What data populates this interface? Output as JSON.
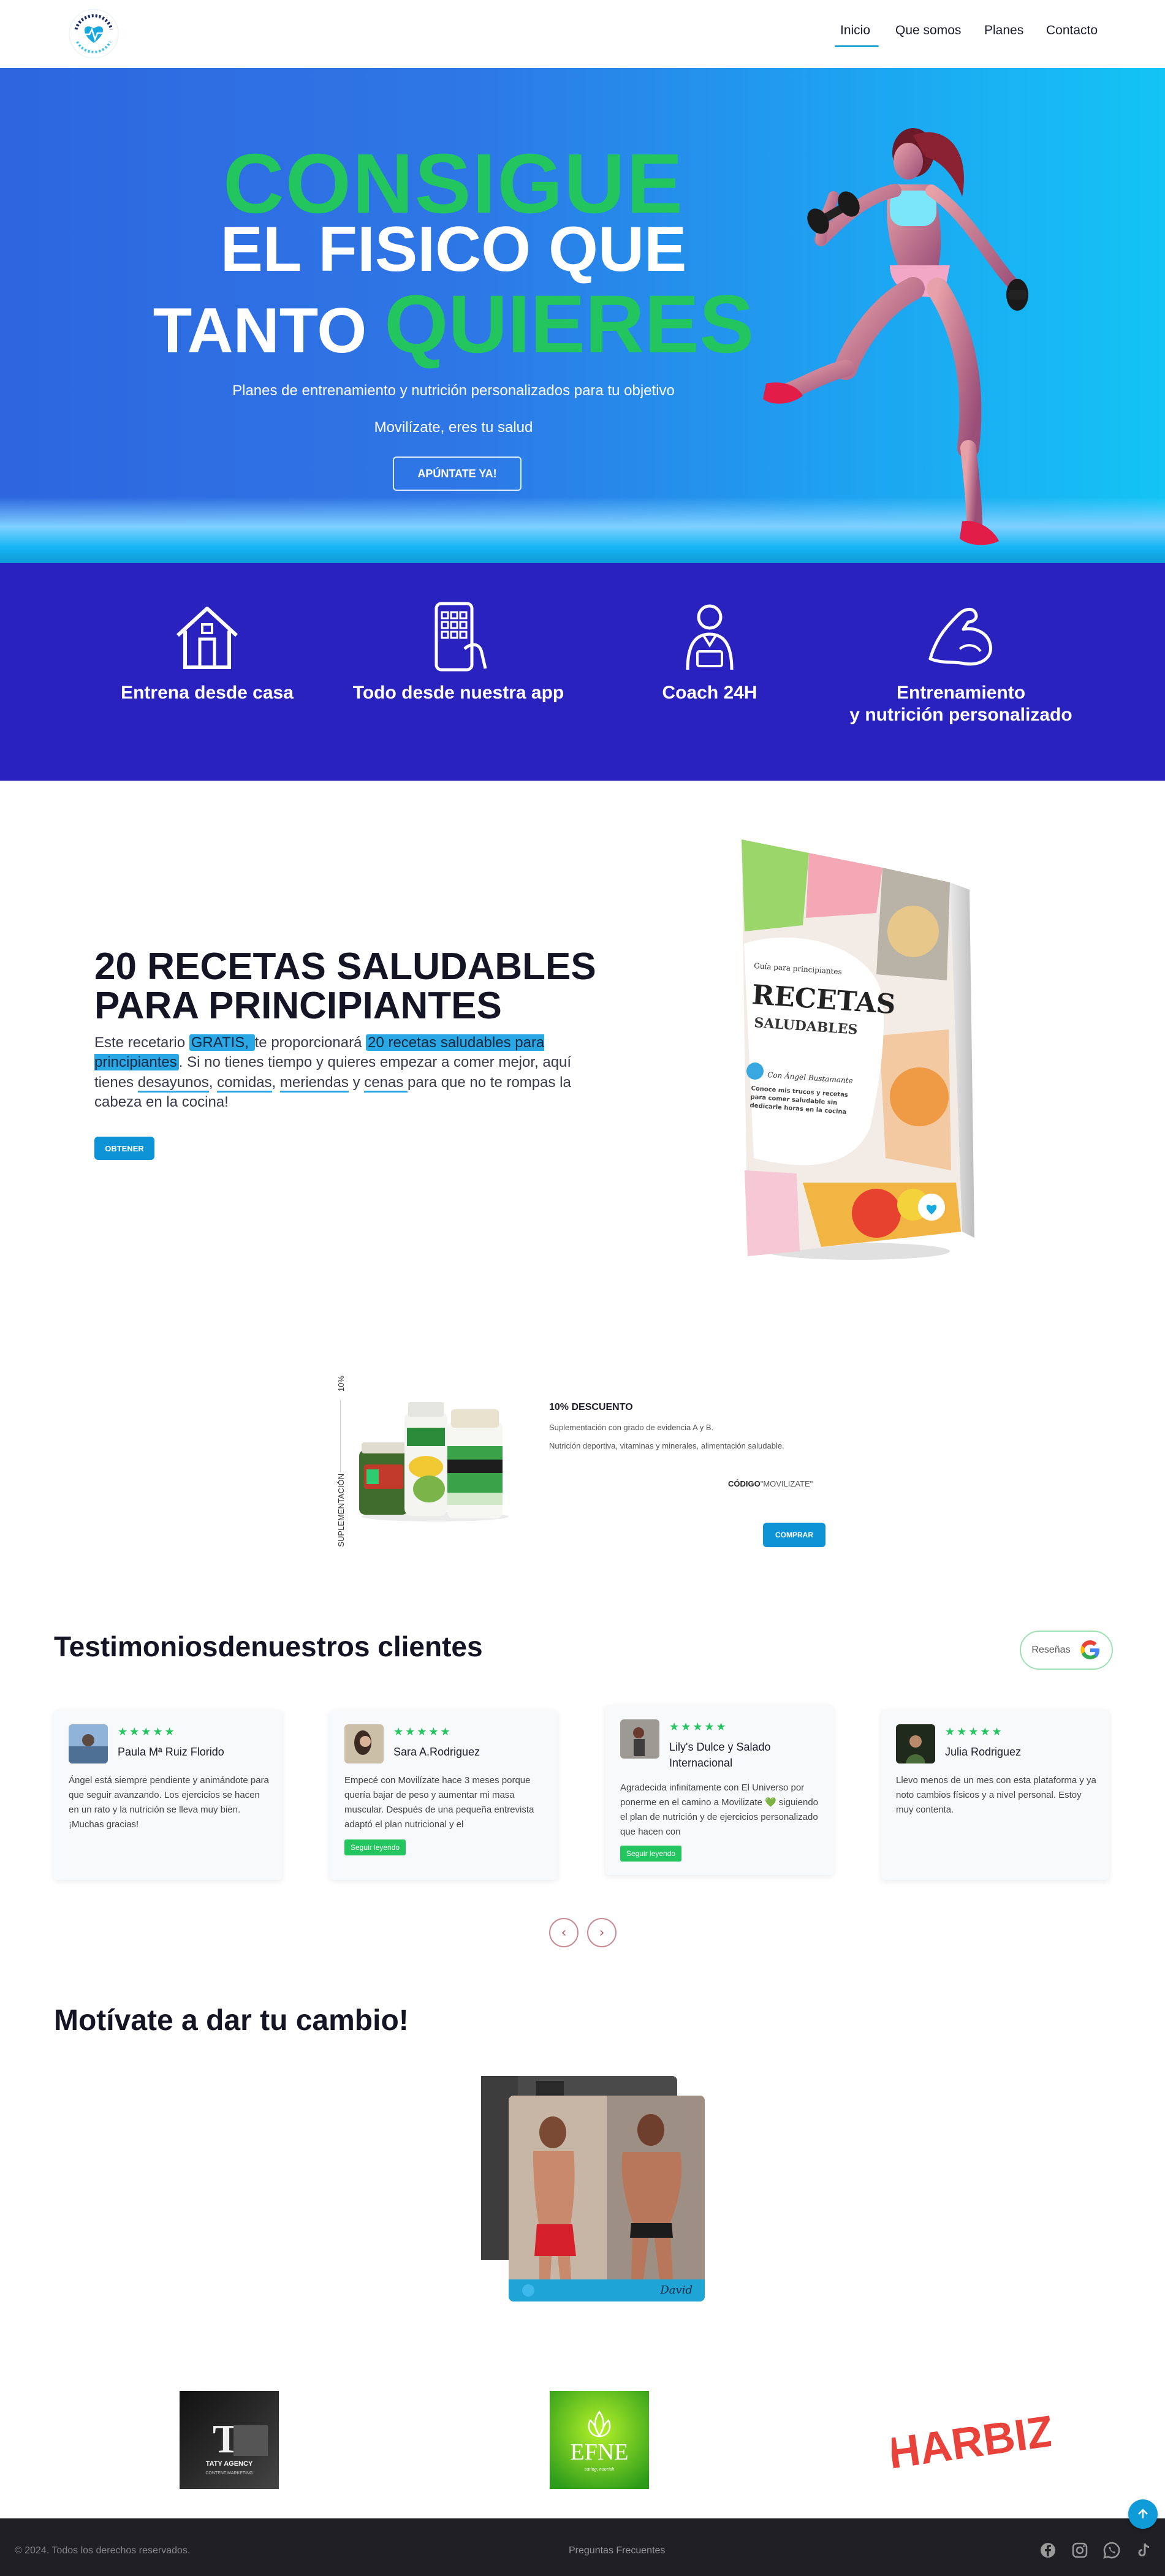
{
  "nav": {
    "logo_alt": "Movilízate",
    "links": [
      "Inicio",
      "Que somos",
      "Planes",
      "Contacto"
    ],
    "active": "Inicio"
  },
  "hero": {
    "line1": "CONSIGUE",
    "line2": "EL FISICO QUE",
    "line3_white": "TANTO",
    "line3_green": "QUIERES",
    "subtitle": "Planes de entrenamiento y nutrición personalizados para tu objetivo",
    "tagline": "Movilízate, eres tu salud",
    "cta": "APÚNTATE YA!"
  },
  "features": [
    {
      "icon": "house-icon",
      "label": "Entrena desde casa"
    },
    {
      "icon": "phone-app-icon",
      "label": "Todo desde nuestra app"
    },
    {
      "icon": "coach-icon",
      "label": "Coach 24H"
    },
    {
      "icon": "bicep-icon",
      "label_line1": "Entrenamiento",
      "label_line2": "y nutrición personalizado"
    }
  ],
  "recipes": {
    "title_line1": "20 RECETAS SALUDABLES",
    "title_line2": "PARA PRINCIPIANTES",
    "text_parts": [
      "Este recetario ",
      "GRATIS, ",
      "te proporcionará ",
      "20 recetas saludables para principiantes",
      ". Si no tienes tiempo y quieres empezar a comer mejor, aquí tienes ",
      "desayunos",
      ", ",
      "comidas",
      ", ",
      "meriendas",
      " y ",
      "cenas ",
      "para que no te rompas la cabeza en la cocina!"
    ],
    "button": "OBTENER",
    "book": {
      "kicker": "Guía para principiantes",
      "title1": "RECETAS",
      "title2": "SALUDABLES",
      "author": "Con Ángel Bustamante",
      "blurb": "Conoce mis trucos y recetas para comer saludable sin dedicarle horas en la cocina"
    }
  },
  "supplements": {
    "vertical_top": "10%",
    "vertical_bottom": "SUPLEMENTACIÓN",
    "title": "10% DESCUENTO",
    "line1": "Suplementación con grado de evidencia A y B.",
    "line2": "Nutrición deportiva, vitaminas y minerales, alimentación saludable.",
    "code_label": "CÓDIGO",
    "code_value": "\"MOVILIZATE\"",
    "button": "COMPRAR"
  },
  "testimonials": {
    "title_part1": "Testimonios",
    "title_part2": "de",
    "title_part3": "nuestros clientes",
    "reviews_label": "Reseñas",
    "stars": "★★★★★",
    "items": [
      {
        "name": "Paula Mª Ruiz Florido",
        "text": "Ángel está siempre pendiente y animándote para que seguir avanzando. Los ejercicios se hacen en un rato y la nutrición se lleva muy bien. ¡Muchas gracias!",
        "more": ""
      },
      {
        "name": "Sara A.Rodriguez",
        "text": "Empecé con Movilízate hace 3 meses porque quería bajar de peso y aumentar mi masa muscular. Después de una pequeña entrevista adaptó el plan nutricional y el",
        "more": "Seguir leyendo"
      },
      {
        "name": "Lily's Dulce y Salado Internacional",
        "text": "Agradecida infinitamente con El Universo por ponerme en el camino a Movilizate 💚 siguiendo el plan de nutrición y de ejercicios personalizado que hacen con",
        "more": "Seguir leyendo"
      },
      {
        "name": "Julia Rodriguez",
        "text": "Llevo menos de un mes con esta plataforma y ya noto cambios físicos y a nivel personal. Estoy muy contenta.",
        "more": ""
      }
    ],
    "prev": "‹",
    "next": "›"
  },
  "motivate": {
    "title": "Motívate a dar tu cambio!",
    "caption": "David"
  },
  "partners": [
    {
      "name": "TATY AGENCY",
      "sub": "CONTENT MARKETING",
      "mark": "TA"
    },
    {
      "name": "EFNE",
      "sub": "eating, nourish"
    },
    {
      "name": "HARBIZ"
    }
  ],
  "footer": {
    "copyright": "© 2024. Todos los derechos reservados.",
    "faq": "Preguntas Frecuentes",
    "social": [
      "facebook-icon",
      "instagram-icon",
      "whatsapp-icon",
      "tiktok-icon"
    ]
  },
  "colors": {
    "accent_green": "#22c55e",
    "accent_blue": "#0b93d6",
    "features_bg": "#2a22be",
    "footer_bg": "#1f1f24"
  }
}
